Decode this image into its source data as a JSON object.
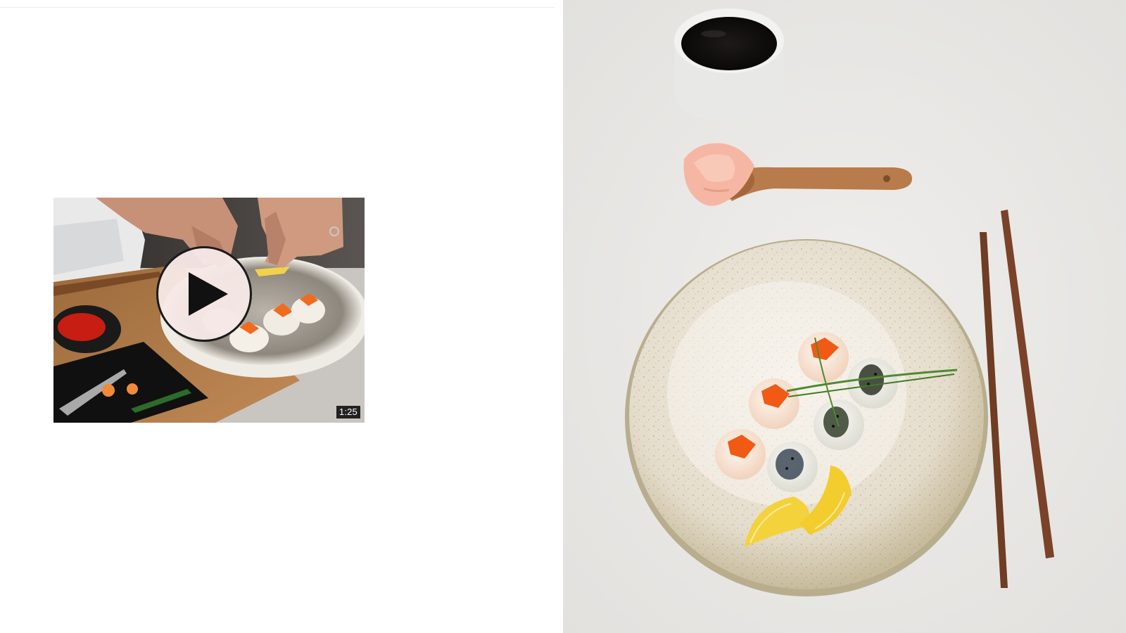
{
  "video": {
    "duration": "1:25",
    "play_icon": "play-icon"
  },
  "photo": {
    "subject": "sushi-plate-photo"
  },
  "colors": {
    "background": "#ffffff",
    "divider": "#e6eceb",
    "photo_backdrop": "#ecebe8",
    "play_button_fill": "#f6e8e6",
    "play_icon": "#111111",
    "badge_bg": "#0a0a0a"
  }
}
